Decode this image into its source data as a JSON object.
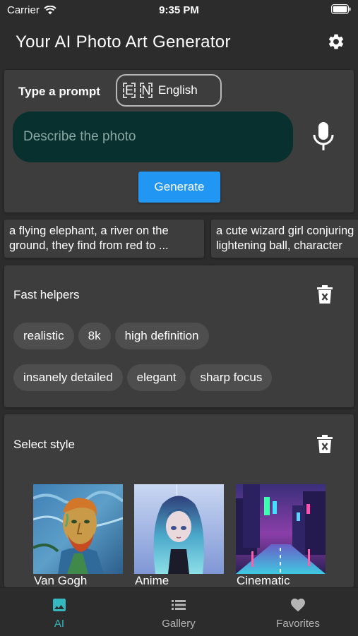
{
  "status_bar": {
    "carrier": "Carrier",
    "time": "9:35 PM"
  },
  "header": {
    "title": "Your AI Photo Art Generator",
    "settings_icon": "gear-icon"
  },
  "prompt": {
    "label": "Type a prompt",
    "language_letters": [
      "E",
      "N"
    ],
    "language_name": "English",
    "placeholder": "Describe the photo",
    "value": "",
    "generate_label": "Generate",
    "mic_icon": "microphone-icon"
  },
  "suggestions": [
    {
      "line1": "a flying elephant, a river on the",
      "line2": "ground, they find from red to ..."
    },
    {
      "line1": "a cute wizard girl conjuring",
      "line2": "lightening ball, character"
    }
  ],
  "helpers": {
    "title": "Fast helpers",
    "row1": [
      "realistic",
      "8k",
      "high definition"
    ],
    "row2": [
      "insanely detailed",
      "elegant",
      "sharp focus"
    ]
  },
  "styles": {
    "title": "Select style",
    "items": [
      {
        "label": "Van Gogh"
      },
      {
        "label": "Anime"
      },
      {
        "label": "Cinematic"
      }
    ]
  },
  "nav": [
    {
      "label": "AI",
      "icon": "image-icon",
      "active": true
    },
    {
      "label": "Gallery",
      "icon": "list-icon",
      "active": false
    },
    {
      "label": "Favorites",
      "icon": "heart-icon",
      "active": false
    }
  ],
  "colors": {
    "background": "#2c2c2c",
    "card": "#3d3d3d",
    "input_bg": "#07302e",
    "primary": "#2196f3",
    "active_tab": "#35b9c0",
    "chip": "#4e4e4e"
  }
}
